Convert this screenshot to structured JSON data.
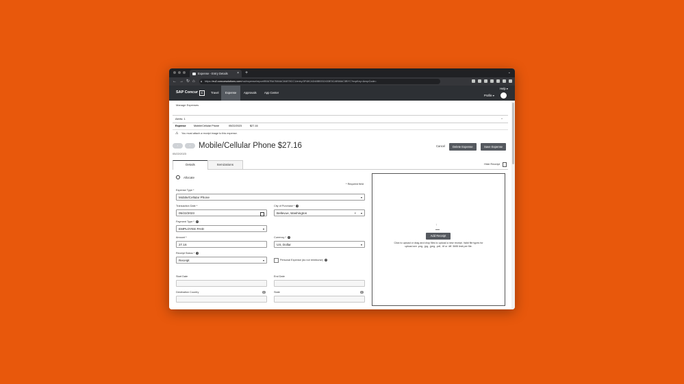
{
  "browser": {
    "tab_title": "Expense - Entry Details",
    "tab_close": "×",
    "new_tab": "+",
    "url_prefix": "https://",
    "url_host": "eu2.concursolutions.com",
    "url_path": "/nui/expense/report/B9A7BA7684AC84878CC1/entry/3F48CAD48B5332433E3CAE68AC3BYC?expKey=&expCode=",
    "nav": {
      "back": "←",
      "forward": "→",
      "reload": "↻",
      "home": "⌂"
    }
  },
  "app": {
    "logo": "SAP Concur",
    "logo_mark": "C",
    "nav_items": [
      "Travel",
      "Expense",
      "Approvals",
      "App Center"
    ],
    "active_nav": "Expense",
    "help": "Help ▾",
    "profile": "Profile ▾"
  },
  "breadcrumb": "Manage Expenses",
  "alerts": {
    "label": "Alerts: 1",
    "caret": "^"
  },
  "expense_row": {
    "type_label": "Expense",
    "name": "Mobile/Cellular Phone",
    "date": "05/22/2023",
    "amount": "$27.16"
  },
  "warning": "You must attach a receipt image to this expense.",
  "pager": {
    "prev": "‹",
    "next": "›"
  },
  "header": {
    "title": "Mobile/Cellular Phone $27.16",
    "date": "05/22/2023"
  },
  "actions": {
    "cancel": "Cancel",
    "delete": "Delete Expense",
    "save": "Save Expense"
  },
  "tabs": [
    "Details",
    "Itemizations"
  ],
  "hide_receipt": "Hide Receipt",
  "form": {
    "allocate": "Allocate",
    "required_note": "* Required field",
    "expense_type_label": "Expense Type *",
    "expense_type": "Mobile/Cellular Phone",
    "transaction_date_label": "Transaction Date *",
    "transaction_date": "05/22/2023",
    "city_label": "City of Purchase *",
    "city": "Bellevue, Washington",
    "payment_type_label": "Payment Type *",
    "payment_type": "EMPLOYEE PAID",
    "amount_label": "Amount *",
    "amount": "27.16",
    "currency_label": "Currency *",
    "currency": "US, Dollar",
    "receipt_status_label": "Receipt Status *",
    "receipt_status": "Receipt",
    "personal_label": "Personal Expense (do not reimburse)",
    "start_date_label": "Start Date",
    "end_date_label": "End Date",
    "dest_country_label": "Destination Country",
    "state_label": "State",
    "dest_badge": "0",
    "state_badge": "0"
  },
  "receipt": {
    "add_button": "Add Receipt",
    "instructions": "Click to upload or drag and drop files to upload a new receipt. Valid file types for upload are .png, .jpg, .jpeg, .pdf, .tif or .tiff. 5MB limit per file."
  }
}
